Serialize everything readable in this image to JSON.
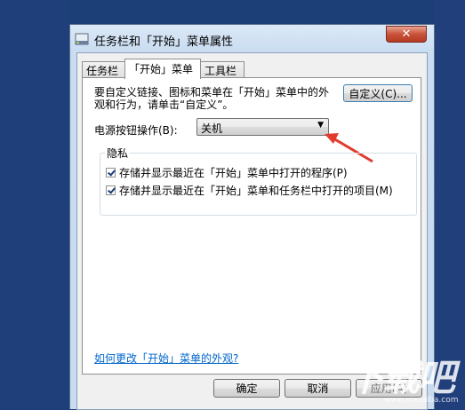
{
  "window": {
    "title": "任务栏和「开始」菜单属性",
    "close_glyph": "✕"
  },
  "tabs": [
    {
      "label": "任务栏"
    },
    {
      "label": "「开始」菜单",
      "active": true
    },
    {
      "label": "工具栏"
    }
  ],
  "start_menu": {
    "description": "要自定义链接、图标和菜单在「开始」菜单中的外观和行为，请单击“自定义”。",
    "customize_label": "自定义(C)...",
    "power_button_label": "电源按钮操作(B):",
    "power_button_value": "关机",
    "privacy_group_title": "隐私",
    "privacy_options": [
      {
        "label": "存储并显示最近在「开始」菜单中打开的程序(P)",
        "checked": true
      },
      {
        "label": "存储并显示最近在「开始」菜单和任务栏中打开的项目(M)",
        "checked": true
      }
    ],
    "help_link": "如何更改「开始」菜单的外观?"
  },
  "buttons": {
    "ok": "确定",
    "cancel": "取消",
    "apply": "应用(A)"
  },
  "watermark": {
    "logo_text": "下载吧",
    "url": "www.xiazaiba.com"
  },
  "colors": {
    "desktop": "#1c3f78",
    "annotation_arrow": "#e23b2e",
    "link": "#0066cc"
  }
}
